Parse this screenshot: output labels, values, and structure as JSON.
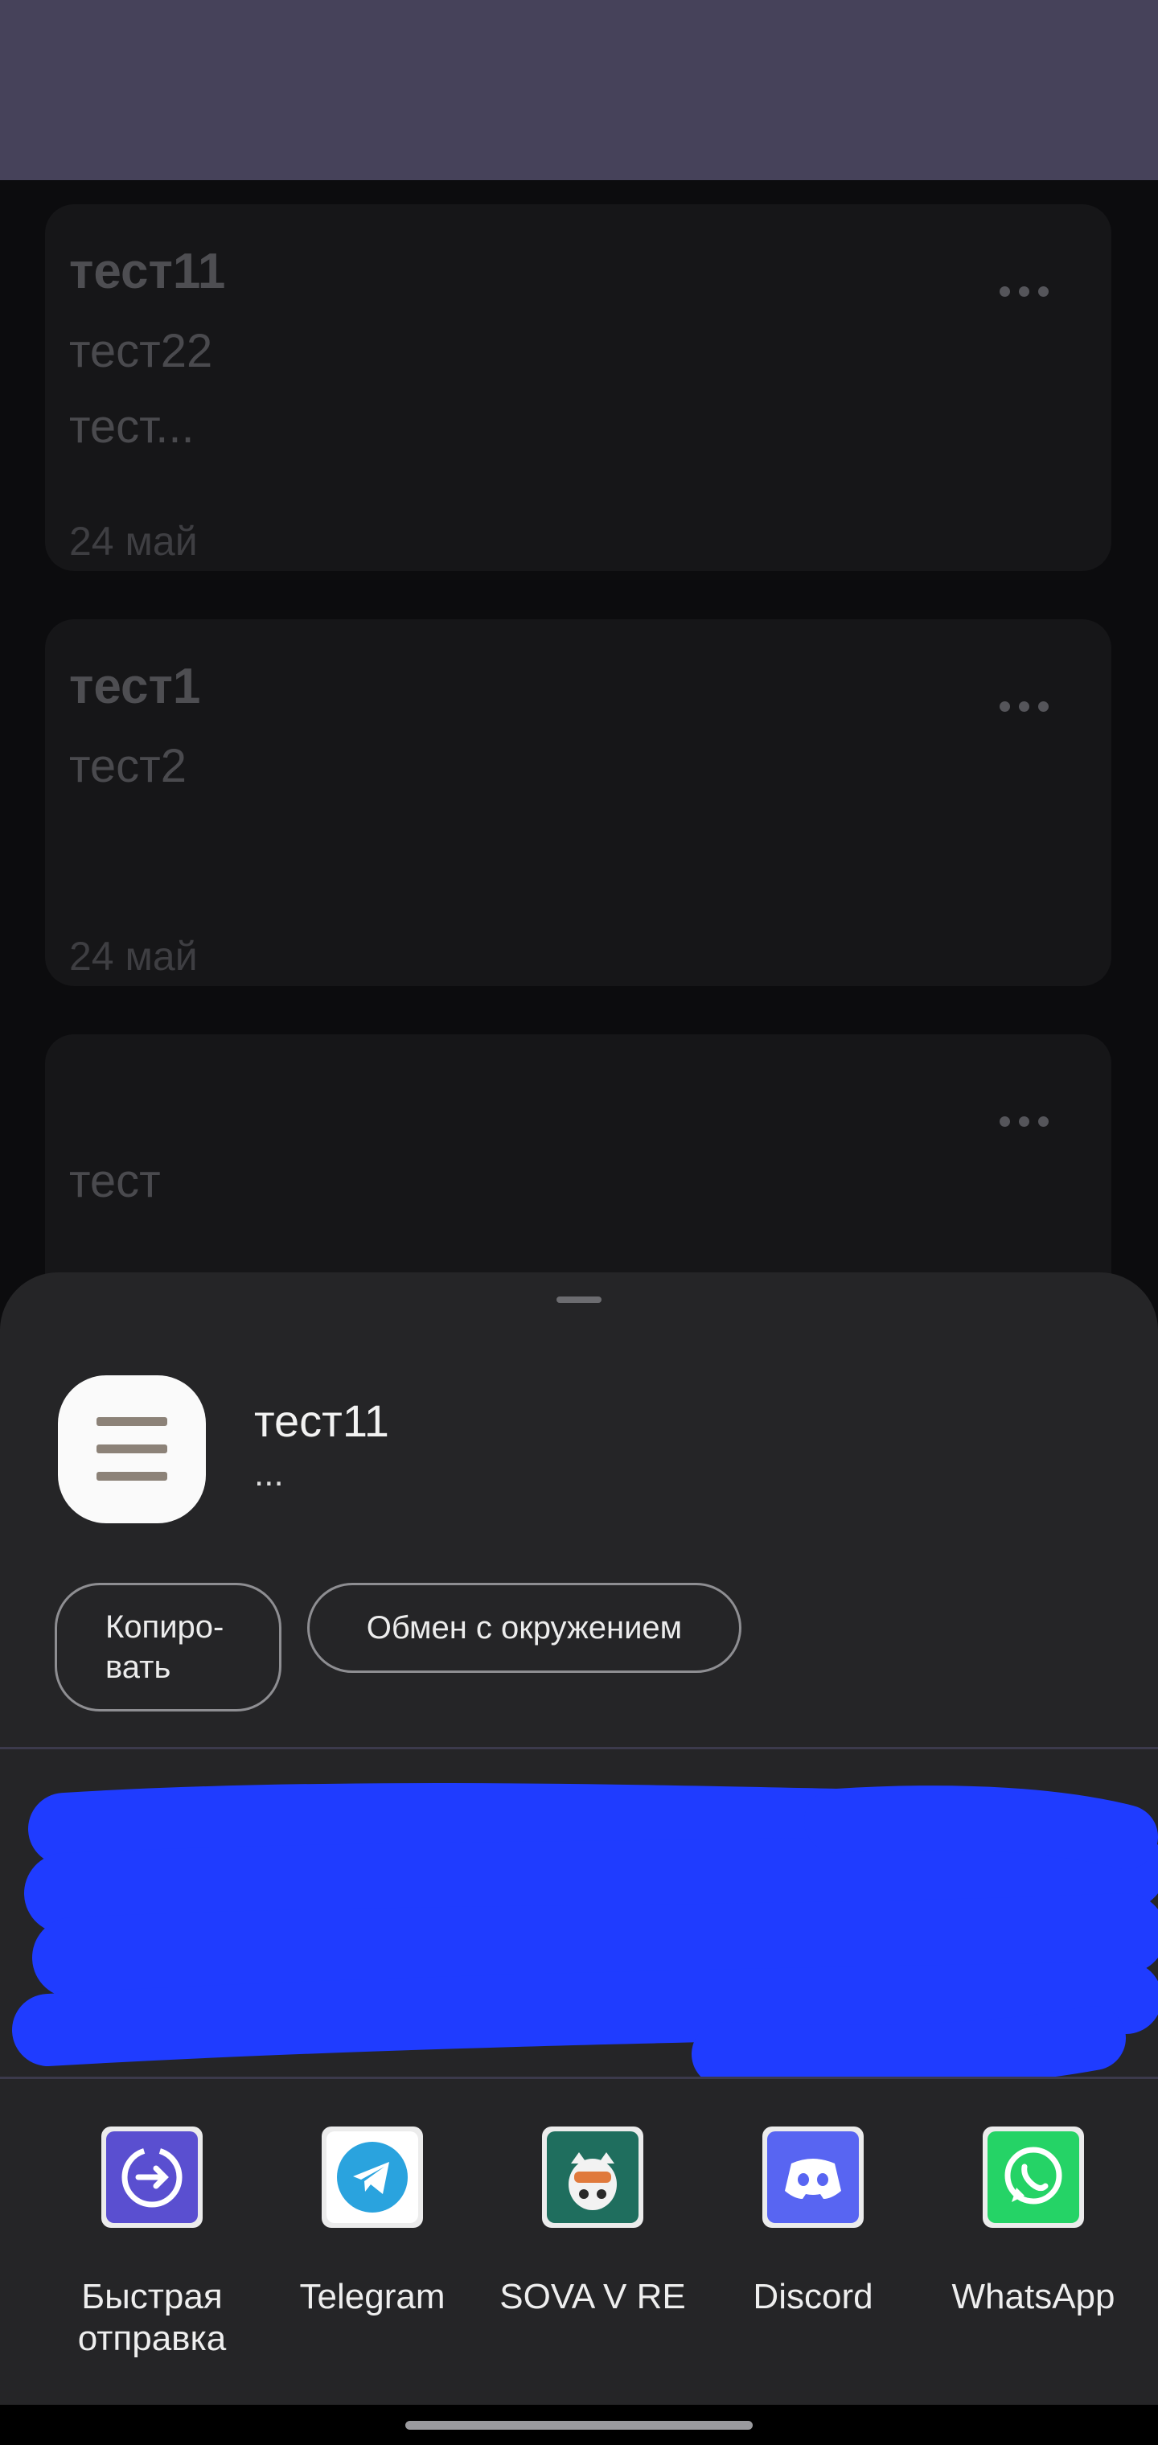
{
  "notes": [
    {
      "title": "тест11",
      "body": "тест22\nтест...",
      "date": "24 май"
    },
    {
      "title": "тест1",
      "body": "тест2",
      "date": "24 май"
    },
    {
      "title": "",
      "body": "тест",
      "date": ""
    }
  ],
  "share_sheet": {
    "title": "тест11",
    "subtitle": "...",
    "actions": {
      "copy": "Копиро-\nвать",
      "nearby": "Обмен с окружением"
    },
    "contacts_peek_text": "...",
    "apps": [
      {
        "label": "Быстрая\nотправка",
        "icon": "quick-share-icon",
        "color": "#5a4fd0"
      },
      {
        "label": "Telegram",
        "icon": "telegram-icon",
        "color": "#2aa3de"
      },
      {
        "label": "SOVA V RE",
        "icon": "sova-icon",
        "color": "#1f6e5e"
      },
      {
        "label": "Discord",
        "icon": "discord-icon",
        "color": "#5865f2"
      },
      {
        "label": "WhatsApp",
        "icon": "whatsapp-icon",
        "color": "#25d366"
      }
    ]
  },
  "colors": {
    "appbar": "#46425a",
    "sheet": "#252527",
    "redaction": "#1f3cff"
  }
}
